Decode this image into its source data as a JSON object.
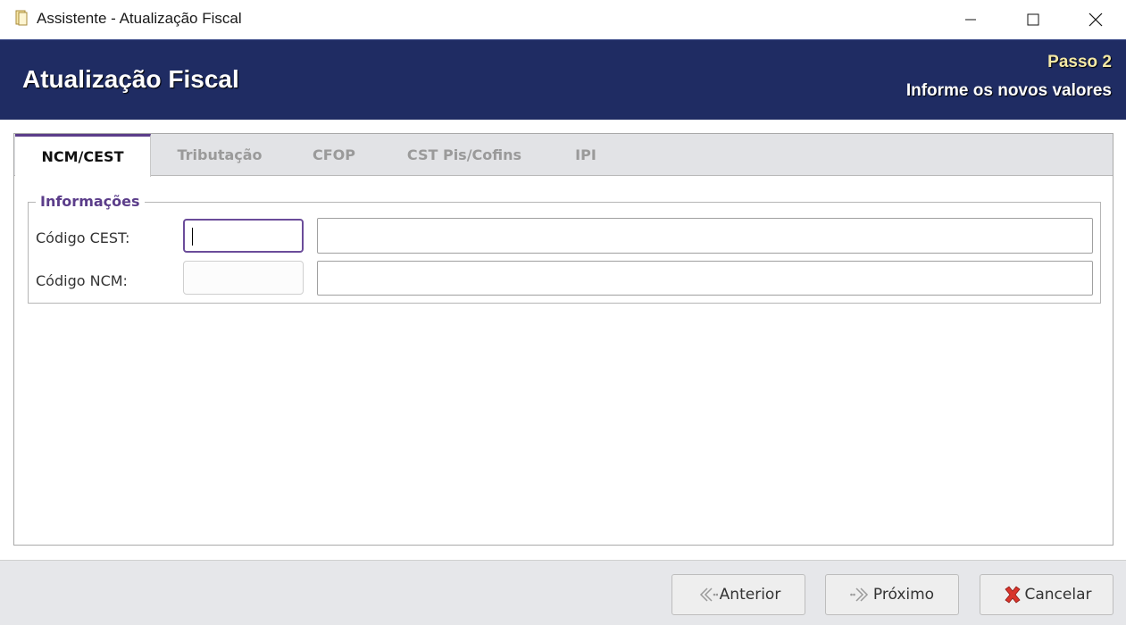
{
  "window": {
    "title": "Assistente - Atualização Fiscal"
  },
  "banner": {
    "title": "Atualização Fiscal",
    "step": "Passo 2",
    "subtitle": "Informe os novos valores"
  },
  "tabs": [
    {
      "label": "NCM/CEST",
      "active": true
    },
    {
      "label": "Tributação",
      "active": false
    },
    {
      "label": "CFOP",
      "active": false
    },
    {
      "label": "CST Pis/Cofins",
      "active": false
    },
    {
      "label": "IPI",
      "active": false
    }
  ],
  "group": {
    "legend": "Informações",
    "fields": [
      {
        "label": "Código CEST:",
        "code_value": "",
        "description_value": ""
      },
      {
        "label": "Código NCM:",
        "code_value": "",
        "description_value": ""
      }
    ]
  },
  "buttons": {
    "previous": "Anterior",
    "next": "Próximo",
    "cancel": "Cancelar"
  },
  "colors": {
    "banner_bg": "#1f2c63",
    "step_text": "#f4e9a6",
    "accent_purple": "#5b3d8a",
    "cancel_red": "#d9342b"
  },
  "icons": [
    "app-document-icon",
    "minimize-icon",
    "maximize-icon",
    "close-icon",
    "arrow-left-icon",
    "arrow-right-icon",
    "cancel-x-icon"
  ]
}
